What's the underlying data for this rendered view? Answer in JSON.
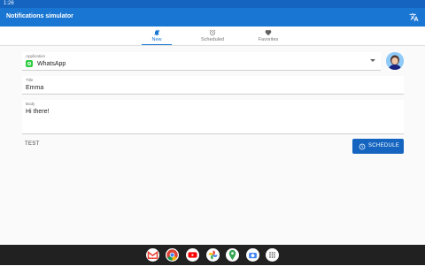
{
  "status_bar": {
    "time": "1:26"
  },
  "app_bar": {
    "title": "Notifications simulator",
    "translate_icon": "translate-icon"
  },
  "tabs": [
    {
      "label": "New",
      "icon": "bell-plus-icon",
      "active": true
    },
    {
      "label": "Scheduled",
      "icon": "alarm-clock-icon",
      "active": false
    },
    {
      "label": "Favorites",
      "icon": "heart-icon",
      "active": false
    }
  ],
  "form": {
    "application": {
      "label": "Application",
      "value": "WhatsApp",
      "icon": "whatsapp-icon"
    },
    "title": {
      "label": "Title",
      "value": "Emma"
    },
    "body": {
      "label": "Body",
      "value": "Hi there!"
    }
  },
  "actions": {
    "test_label": "TEST",
    "schedule_label": "SCHEDULE"
  },
  "dock": {
    "apps": [
      "gmail-icon",
      "chrome-icon",
      "youtube-icon",
      "photos-icon",
      "maps-icon",
      "camera-icon",
      "app-drawer-icon"
    ]
  },
  "colors": {
    "primary": "#1976d2",
    "primary_dark": "#1565c0",
    "accent_app": "#2ecc40"
  }
}
